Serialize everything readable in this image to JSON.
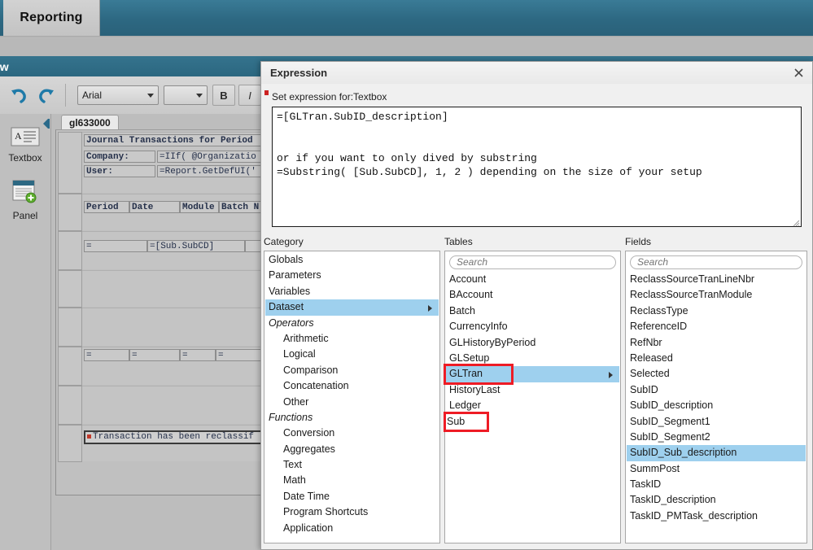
{
  "app": {
    "tab_label": "Reporting"
  },
  "designer": {
    "window_title": "ew",
    "toolbar": {
      "undo_icon": "undo-icon",
      "redo_icon": "redo-icon",
      "font_family": "Arial",
      "font_size": "",
      "bold_label": "B",
      "italic_label": "I"
    },
    "toolbox": [
      {
        "icon": "textbox-icon",
        "label": "Textbox"
      },
      {
        "icon": "panel-icon",
        "label": "Panel"
      }
    ],
    "report_tab": "gl633000",
    "cells": {
      "title": "Journal Transactions for Period",
      "company_label": "Company:",
      "company_value": "=IIf( @Organizatio",
      "user_label": "User:",
      "user_value": "=Report.GetDefUI('",
      "headers": [
        "Period",
        "Date",
        "Module",
        "Batch N"
      ],
      "detail_equals": "=",
      "detail_subcd": "=[Sub.SubCD]",
      "footer_equals": [
        "=",
        "=",
        "=",
        "="
      ],
      "reclassified": "Transaction has been reclassif"
    }
  },
  "dialog": {
    "title": "Expression",
    "close_icon": "close-icon",
    "set_expression_label": "Set expression for:Textbox",
    "expression_value": "=[GLTran.SubID_description]\n\n\nor if you want to only dived by substring\n=Substring( [Sub.SubCD], 1, 2 ) depending on the size of your setup",
    "category": {
      "header": "Category",
      "items": [
        {
          "label": "Globals",
          "indent": false,
          "italic": false,
          "selected": false,
          "submenu": false
        },
        {
          "label": "Parameters",
          "indent": false,
          "italic": false,
          "selected": false,
          "submenu": false
        },
        {
          "label": "Variables",
          "indent": false,
          "italic": false,
          "selected": false,
          "submenu": false
        },
        {
          "label": "Dataset",
          "indent": false,
          "italic": false,
          "selected": true,
          "submenu": true
        },
        {
          "label": "Operators",
          "indent": false,
          "italic": true,
          "selected": false,
          "submenu": false
        },
        {
          "label": "Arithmetic",
          "indent": true,
          "italic": false,
          "selected": false,
          "submenu": false
        },
        {
          "label": "Logical",
          "indent": true,
          "italic": false,
          "selected": false,
          "submenu": false
        },
        {
          "label": "Comparison",
          "indent": true,
          "italic": false,
          "selected": false,
          "submenu": false
        },
        {
          "label": "Concatenation",
          "indent": true,
          "italic": false,
          "selected": false,
          "submenu": false
        },
        {
          "label": "Other",
          "indent": true,
          "italic": false,
          "selected": false,
          "submenu": false
        },
        {
          "label": "Functions",
          "indent": false,
          "italic": true,
          "selected": false,
          "submenu": false
        },
        {
          "label": "Conversion",
          "indent": true,
          "italic": false,
          "selected": false,
          "submenu": false
        },
        {
          "label": "Aggregates",
          "indent": true,
          "italic": false,
          "selected": false,
          "submenu": false
        },
        {
          "label": "Text",
          "indent": true,
          "italic": false,
          "selected": false,
          "submenu": false
        },
        {
          "label": "Math",
          "indent": true,
          "italic": false,
          "selected": false,
          "submenu": false
        },
        {
          "label": "Date Time",
          "indent": true,
          "italic": false,
          "selected": false,
          "submenu": false
        },
        {
          "label": "Program Shortcuts",
          "indent": true,
          "italic": false,
          "selected": false,
          "submenu": false
        },
        {
          "label": "Application",
          "indent": true,
          "italic": false,
          "selected": false,
          "submenu": false
        }
      ]
    },
    "tables": {
      "header": "Tables",
      "search_placeholder": "Search",
      "search_value": "",
      "items": [
        {
          "label": "Account",
          "selected": false,
          "submenu": false,
          "annotated": false
        },
        {
          "label": "BAccount",
          "selected": false,
          "submenu": false,
          "annotated": false
        },
        {
          "label": "Batch",
          "selected": false,
          "submenu": false,
          "annotated": false
        },
        {
          "label": "CurrencyInfo",
          "selected": false,
          "submenu": false,
          "annotated": false
        },
        {
          "label": "GLHistoryByPeriod",
          "selected": false,
          "submenu": false,
          "annotated": false
        },
        {
          "label": "GLSetup",
          "selected": false,
          "submenu": false,
          "annotated": false
        },
        {
          "label": "GLTran",
          "selected": true,
          "submenu": true,
          "annotated": true
        },
        {
          "label": "HistoryLast",
          "selected": false,
          "submenu": false,
          "annotated": false
        },
        {
          "label": "Ledger",
          "selected": false,
          "submenu": false,
          "annotated": false
        },
        {
          "label": "Sub",
          "selected": false,
          "submenu": false,
          "annotated": true
        }
      ]
    },
    "fields": {
      "header": "Fields",
      "search_placeholder": "Search",
      "search_value": "",
      "items": [
        {
          "label": "ReclassSourceTranLineNbr",
          "selected": false
        },
        {
          "label": "ReclassSourceTranModule",
          "selected": false
        },
        {
          "label": "ReclassType",
          "selected": false
        },
        {
          "label": "ReferenceID",
          "selected": false
        },
        {
          "label": "RefNbr",
          "selected": false
        },
        {
          "label": "Released",
          "selected": false
        },
        {
          "label": "Selected",
          "selected": false
        },
        {
          "label": "SubID",
          "selected": false
        },
        {
          "label": "SubID_description",
          "selected": false
        },
        {
          "label": "SubID_Segment1",
          "selected": false
        },
        {
          "label": "SubID_Segment2",
          "selected": false
        },
        {
          "label": "SubID_Sub_description",
          "selected": true
        },
        {
          "label": "SummPost",
          "selected": false
        },
        {
          "label": "TaskID",
          "selected": false
        },
        {
          "label": "TaskID_description",
          "selected": false
        },
        {
          "label": "TaskID_PMTask_description",
          "selected": false
        }
      ]
    }
  },
  "colors": {
    "brand_teal": "#2d6882",
    "selection_blue": "#9ed0ee",
    "annotation_red": "#ee1c25",
    "required_red": "#cc2222"
  }
}
